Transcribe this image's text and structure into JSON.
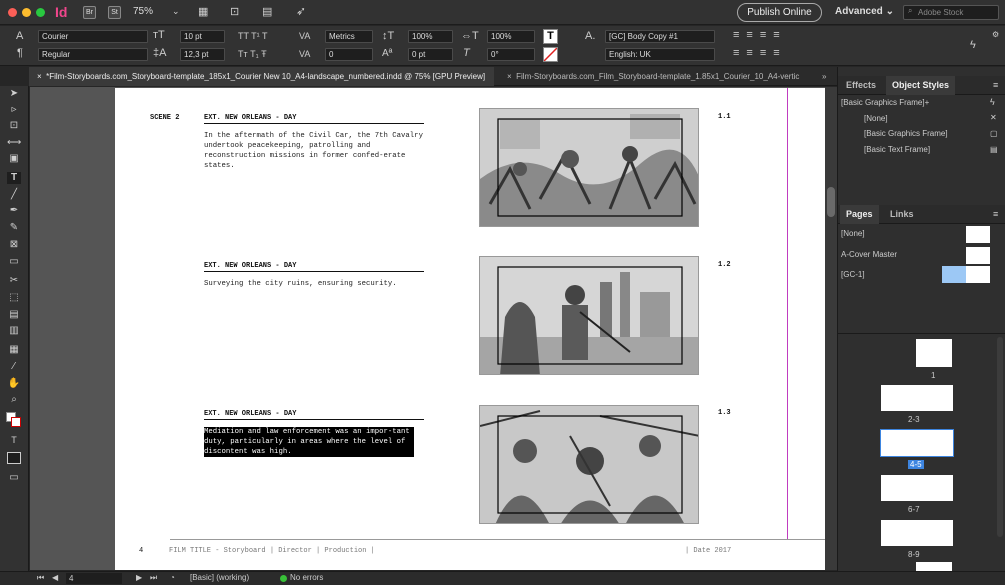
{
  "app": {
    "logo": "Id",
    "bridge": "Br",
    "stock": "St",
    "zoom": "75%",
    "publish": "Publish Online",
    "workspace": "Advanced",
    "search_placeholder": "Adobe Stock"
  },
  "control": {
    "font": "Courier",
    "style": "Regular",
    "size": "10 pt",
    "leading": "12,3 pt",
    "kerning": "Metrics",
    "tracking": "0",
    "vscale": "100%",
    "hscale": "100%",
    "baseline": "0 pt",
    "skew": "0°",
    "para_style": "[GC] Body Copy #1",
    "language": "English: UK"
  },
  "tabs": [
    {
      "label": "*Film-Storyboards.com_Storyboard-template_185x1_Courier New 10_A4-landscape_numbered.indd @ 75% [GPU Preview]",
      "close": "×"
    },
    {
      "label": "Film-Storyboards.com_Film_Storyboard-template_1.85x1_Courier_10_A4-vertic",
      "close": "×"
    },
    {
      "label": "»"
    }
  ],
  "document": {
    "scene_label": "SCENE 2",
    "shots": [
      {
        "heading": "EXT. NEW ORLEANS - DAY",
        "text": "In the aftermath of the Civil Car, the 7th Cavalry undertook peacekeeping, patrolling and reconstruction missions in former confed-erate states.",
        "number": "1.1"
      },
      {
        "heading": "EXT. NEW ORLEANS - DAY",
        "text": "Surveying the city ruins, ensuring security.",
        "number": "1.2"
      },
      {
        "heading": "EXT. NEW ORLEANS - DAY",
        "text": "Mediation and law enforcement was an impor-tant duty, particularly in areas where the level of discontent was high.",
        "number": "1.3"
      }
    ],
    "footer_page": "4",
    "footer_text": "FILM TITLE - Storyboard | Director | Production |",
    "footer_date": "| Date 2017"
  },
  "object_styles": {
    "tabs": [
      "Effects",
      "Object Styles"
    ],
    "current": "[Basic Graphics Frame]+",
    "items": [
      "[None]",
      "[Basic Graphics Frame]",
      "[Basic Text Frame]"
    ]
  },
  "pages_panel": {
    "tabs": [
      "Pages",
      "Links"
    ],
    "masters": [
      "[None]",
      "A-Cover Master",
      "[GC-1]"
    ],
    "spreads": [
      "1",
      "2-3",
      "4-5",
      "6-7",
      "8-9"
    ]
  },
  "status": {
    "page": "4",
    "preflight_profile": "[Basic] (working)",
    "errors": "No errors"
  },
  "colors": {
    "accent": "#3d85e0",
    "selection": "#000000"
  }
}
